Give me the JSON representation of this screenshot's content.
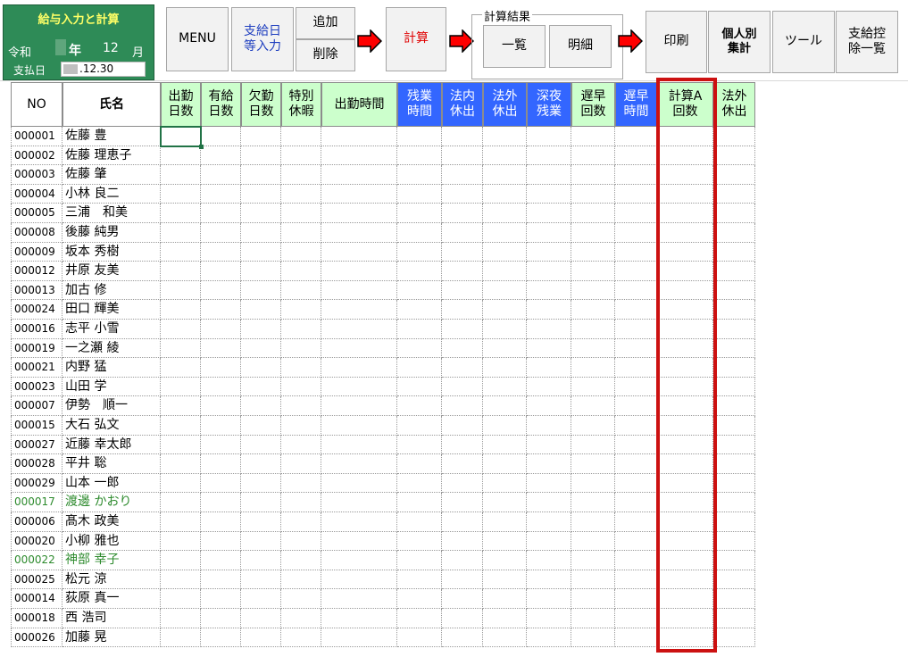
{
  "toolbar": {
    "green_panel": {
      "title": "給与入力と計算",
      "era": "令和",
      "year_label": "年",
      "month_value": "12",
      "month_label": "月",
      "pay_date_label": "支払日",
      "pay_date_value": ".12.30"
    },
    "menu_label": "MENU",
    "pay_date_input_label": "支給日\n等入力",
    "add_label": "追加",
    "delete_label": "削除",
    "calculate_label": "計算",
    "results_group_label": "計算結果",
    "list_label": "一覧",
    "detail_label": "明細",
    "print_label": "印刷",
    "individual_label": "個人別\n集計",
    "tools_label": "ツール",
    "deduction_label": "支給控\n除一覧"
  },
  "columns": {
    "no": "NO",
    "name": "氏名",
    "work_days": "出勤\n日数",
    "paid_leave": "有給\n日数",
    "absence_days": "欠勤\n日数",
    "special_leave": "特別\n休暇",
    "work_hours": "出勤時間",
    "overtime_hours": "残業\n時間",
    "statutory_holiday_in": "法内\n休出",
    "statutory_holiday_out": "法外\n休出",
    "late_night_overtime": "深夜\n残業",
    "late_early_count": "遅早\n回数",
    "late_early_hours": "遅早\n時間",
    "calc_a_count": "計算A\n回数",
    "outside_holiday": "法外\n休出"
  },
  "employees": [
    {
      "no": "000001",
      "name": "佐藤 豊",
      "highlight": false
    },
    {
      "no": "000002",
      "name": "佐藤 理恵子",
      "highlight": false
    },
    {
      "no": "000003",
      "name": "佐藤 肇",
      "highlight": false
    },
    {
      "no": "000004",
      "name": "小林 良二",
      "highlight": false
    },
    {
      "no": "000005",
      "name": "三浦　和美",
      "highlight": false
    },
    {
      "no": "000008",
      "name": "後藤 純男",
      "highlight": false
    },
    {
      "no": "000009",
      "name": "坂本 秀樹",
      "highlight": false
    },
    {
      "no": "000012",
      "name": "井原 友美",
      "highlight": false
    },
    {
      "no": "000013",
      "name": "加古 修",
      "highlight": false
    },
    {
      "no": "000024",
      "name": "田口 輝美",
      "highlight": false
    },
    {
      "no": "000016",
      "name": "志平 小雪",
      "highlight": false
    },
    {
      "no": "000019",
      "name": "一之瀬 綾",
      "highlight": false
    },
    {
      "no": "000021",
      "name": "内野 猛",
      "highlight": false
    },
    {
      "no": "000023",
      "name": "山田 学",
      "highlight": false
    },
    {
      "no": "000007",
      "name": "伊勢　順一",
      "highlight": false
    },
    {
      "no": "000015",
      "name": "大石 弘文",
      "highlight": false
    },
    {
      "no": "000027",
      "name": "近藤 幸太郎",
      "highlight": false
    },
    {
      "no": "000028",
      "name": "平井 聡",
      "highlight": false
    },
    {
      "no": "000029",
      "name": "山本 一郎",
      "highlight": false
    },
    {
      "no": "000017",
      "name": "渡邊 かおり",
      "highlight": true
    },
    {
      "no": "000006",
      "name": "髙木 政美",
      "highlight": false
    },
    {
      "no": "000020",
      "name": "小柳 雅也",
      "highlight": false
    },
    {
      "no": "000022",
      "name": "神部 幸子",
      "highlight": true
    },
    {
      "no": "000025",
      "name": "松元 涼",
      "highlight": false
    },
    {
      "no": "000014",
      "name": "荻原 真一",
      "highlight": false
    },
    {
      "no": "000018",
      "name": "西 浩司",
      "highlight": false
    },
    {
      "no": "000026",
      "name": "加藤 晃",
      "highlight": false
    }
  ],
  "colors": {
    "green_panel": "#2e8b57",
    "header_light_green": "#ccffcc",
    "header_blue": "#3366ff",
    "highlight_frame": "#cc1111",
    "arrow_red": "#ff0000"
  }
}
